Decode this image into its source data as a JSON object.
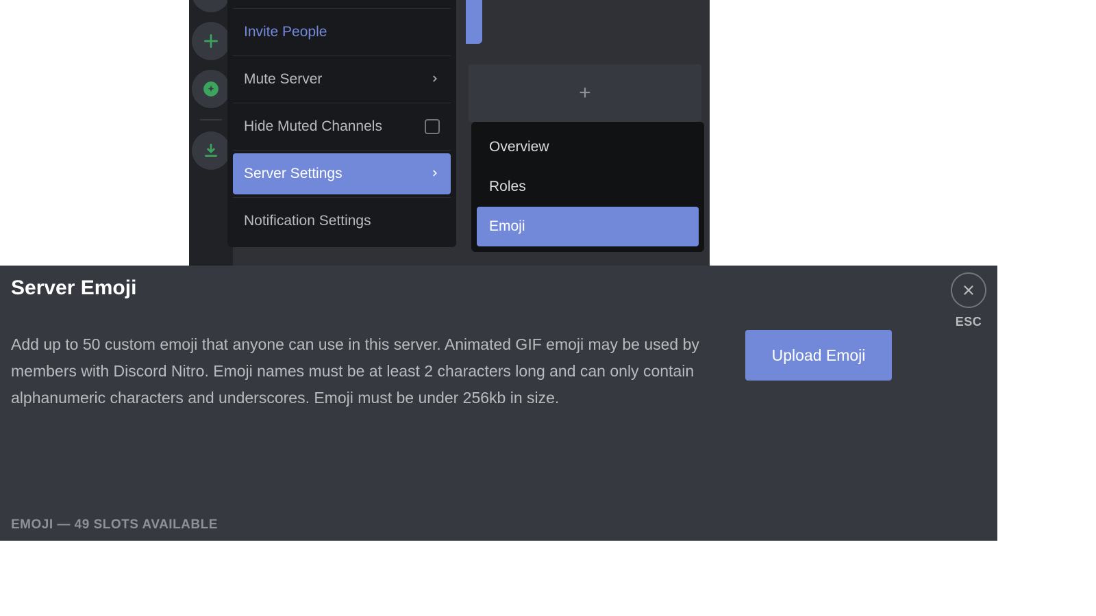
{
  "server_menu": {
    "invite_label": "Invite People",
    "mute_label": "Mute Server",
    "hide_muted_label": "Hide Muted Channels",
    "settings_label": "Server Settings",
    "notifications_label": "Notification Settings"
  },
  "sub_menu": {
    "overview_label": "Overview",
    "roles_label": "Roles",
    "emoji_label": "Emoji"
  },
  "emoji_page": {
    "heading": "Server Emoji",
    "description": "Add up to 50 custom emoji that anyone can use in this server. Animated GIF emoji may be used by members with Discord Nitro. Emoji names must be at least 2 characters long and can only contain alphanumeric characters and underscores. Emoji must be under 256kb in size.",
    "upload_label": "Upload Emoji",
    "esc_label": "ESC",
    "slots_label": "EMOJI — 49 SLOTS AVAILABLE"
  }
}
